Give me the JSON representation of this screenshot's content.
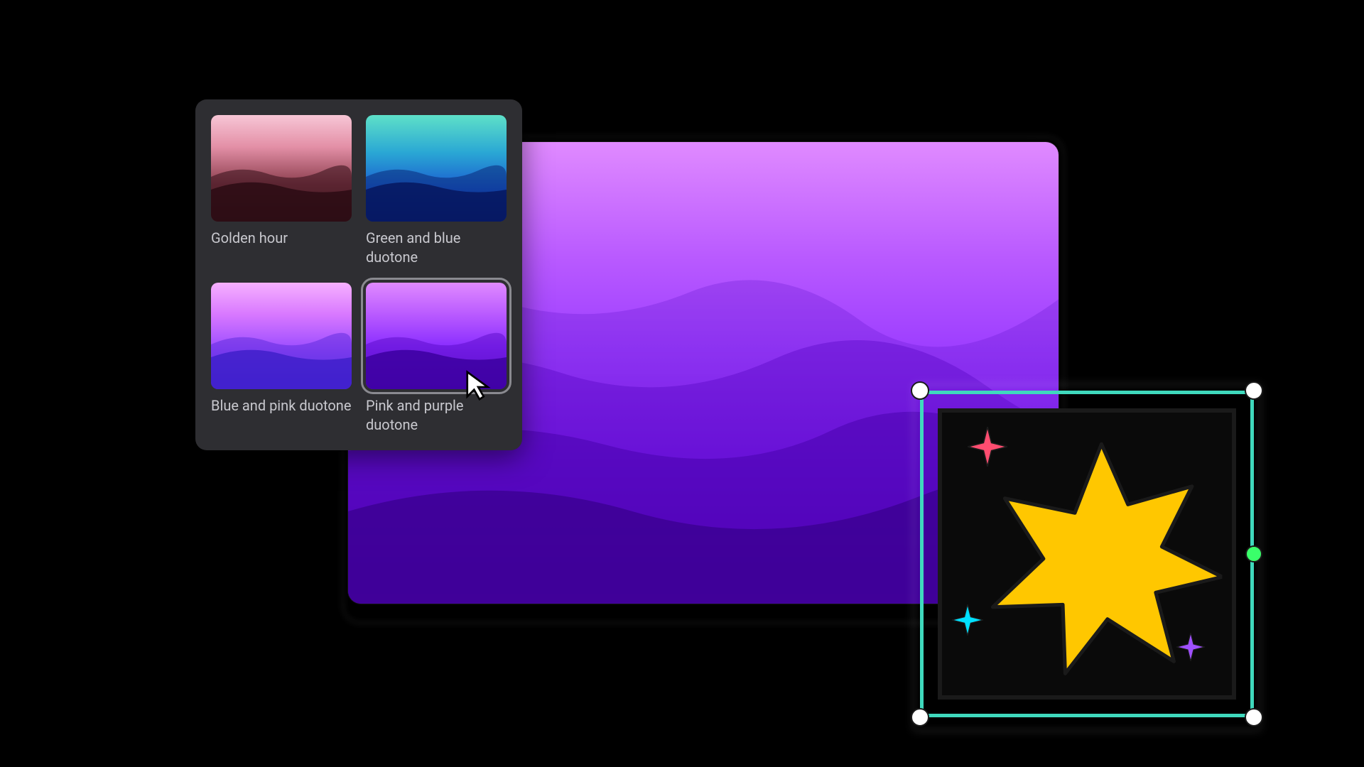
{
  "filters": [
    {
      "id": "golden-hour",
      "label": "Golden hour",
      "gradient": "grad-golden",
      "selected": false
    },
    {
      "id": "green-blue",
      "label": "Green and blue duotone",
      "gradient": "grad-greenblue",
      "selected": false
    },
    {
      "id": "blue-pink",
      "label": "Blue and pink duotone",
      "gradient": "grad-bluepink",
      "selected": false
    },
    {
      "id": "pink-purple",
      "label": "Pink and purple duotone",
      "gradient": "grad-pinkpurple",
      "selected": true
    }
  ],
  "colors": {
    "selection_frame": "#3fd9bd",
    "rotate_handle": "#3aff6a",
    "big_star": "#ffc700",
    "sparkle_red": "#ff4d70",
    "sparkle_cyan": "#00e0ff",
    "sparkle_purple": "#a050ff"
  }
}
